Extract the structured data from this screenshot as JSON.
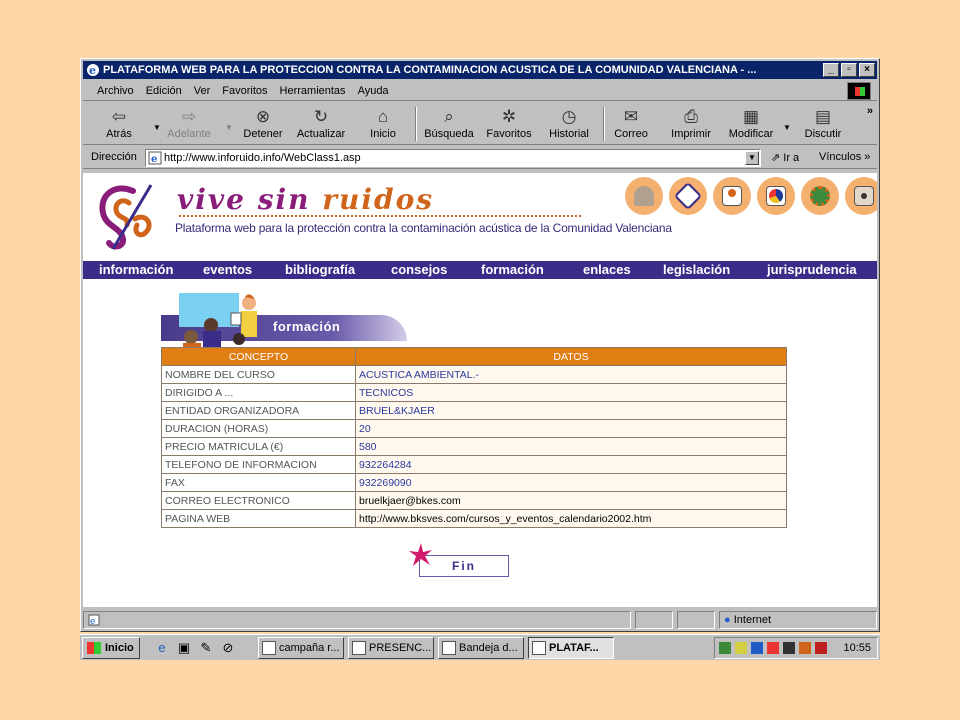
{
  "window": {
    "title": "PLATAFORMA WEB PARA LA PROTECCION CONTRA LA CONTAMINACION ACUSTICA DE LA COMUNIDAD VALENCIANA - ..."
  },
  "menu": [
    "Archivo",
    "Edición",
    "Ver",
    "Favoritos",
    "Herramientas",
    "Ayuda"
  ],
  "toolbar": {
    "back": "Atrás",
    "forward": "Adelante",
    "stop": "Detener",
    "refresh": "Actualizar",
    "home": "Inicio",
    "search": "Búsqueda",
    "favorites": "Favoritos",
    "history": "Historial",
    "mail": "Correo",
    "print": "Imprimir",
    "edit": "Modificar",
    "discuss": "Discutir",
    "more": "»"
  },
  "address": {
    "label": "Dirección",
    "url": "http://www.inforuido.info/WebClass1.asp",
    "go": "Ir a",
    "links": "Vínculos"
  },
  "site": {
    "title_part1": "vive",
    "title_part2": "sin",
    "title_part3": "ruidos",
    "subtitle": "Plataforma web para la protección contra la contaminación acústica de la Comunidad Valenciana"
  },
  "nav": [
    "información",
    "eventos",
    "bibliografía",
    "consejos",
    "formación",
    "enlaces",
    "legislación",
    "jurisprudencia"
  ],
  "section": {
    "label": "formación"
  },
  "table": {
    "headers": [
      "CONCEPTO",
      "DATOS"
    ],
    "rows": [
      [
        "NOMBRE DEL CURSO",
        "ACUSTICA AMBIENTAL.-"
      ],
      [
        "DIRIGIDO A ...",
        "TECNICOS"
      ],
      [
        "ENTIDAD ORGANIZADORA",
        "BRUEL&KJAER"
      ],
      [
        "DURACION (HORAS)",
        "20"
      ],
      [
        "PRECIO MATRICULA (€)",
        "580"
      ],
      [
        "TELEFONO DE INFORMACION",
        "932264284"
      ],
      [
        "FAX",
        "932269090"
      ],
      [
        "CORREO ELECTRONICO",
        "bruelkjaer@bkes.com"
      ],
      [
        "PAGINA WEB",
        "http://www.bksves.com/cursos_y_eventos_calendario2002.htm"
      ]
    ]
  },
  "fin": "Fin",
  "status": {
    "zone": "Internet"
  },
  "taskbar": {
    "start": "Inicio",
    "tasks": [
      "campaña r...",
      "PRESENC...",
      "Bandeja d...",
      "PLATAF..."
    ],
    "clock": "10:55"
  }
}
